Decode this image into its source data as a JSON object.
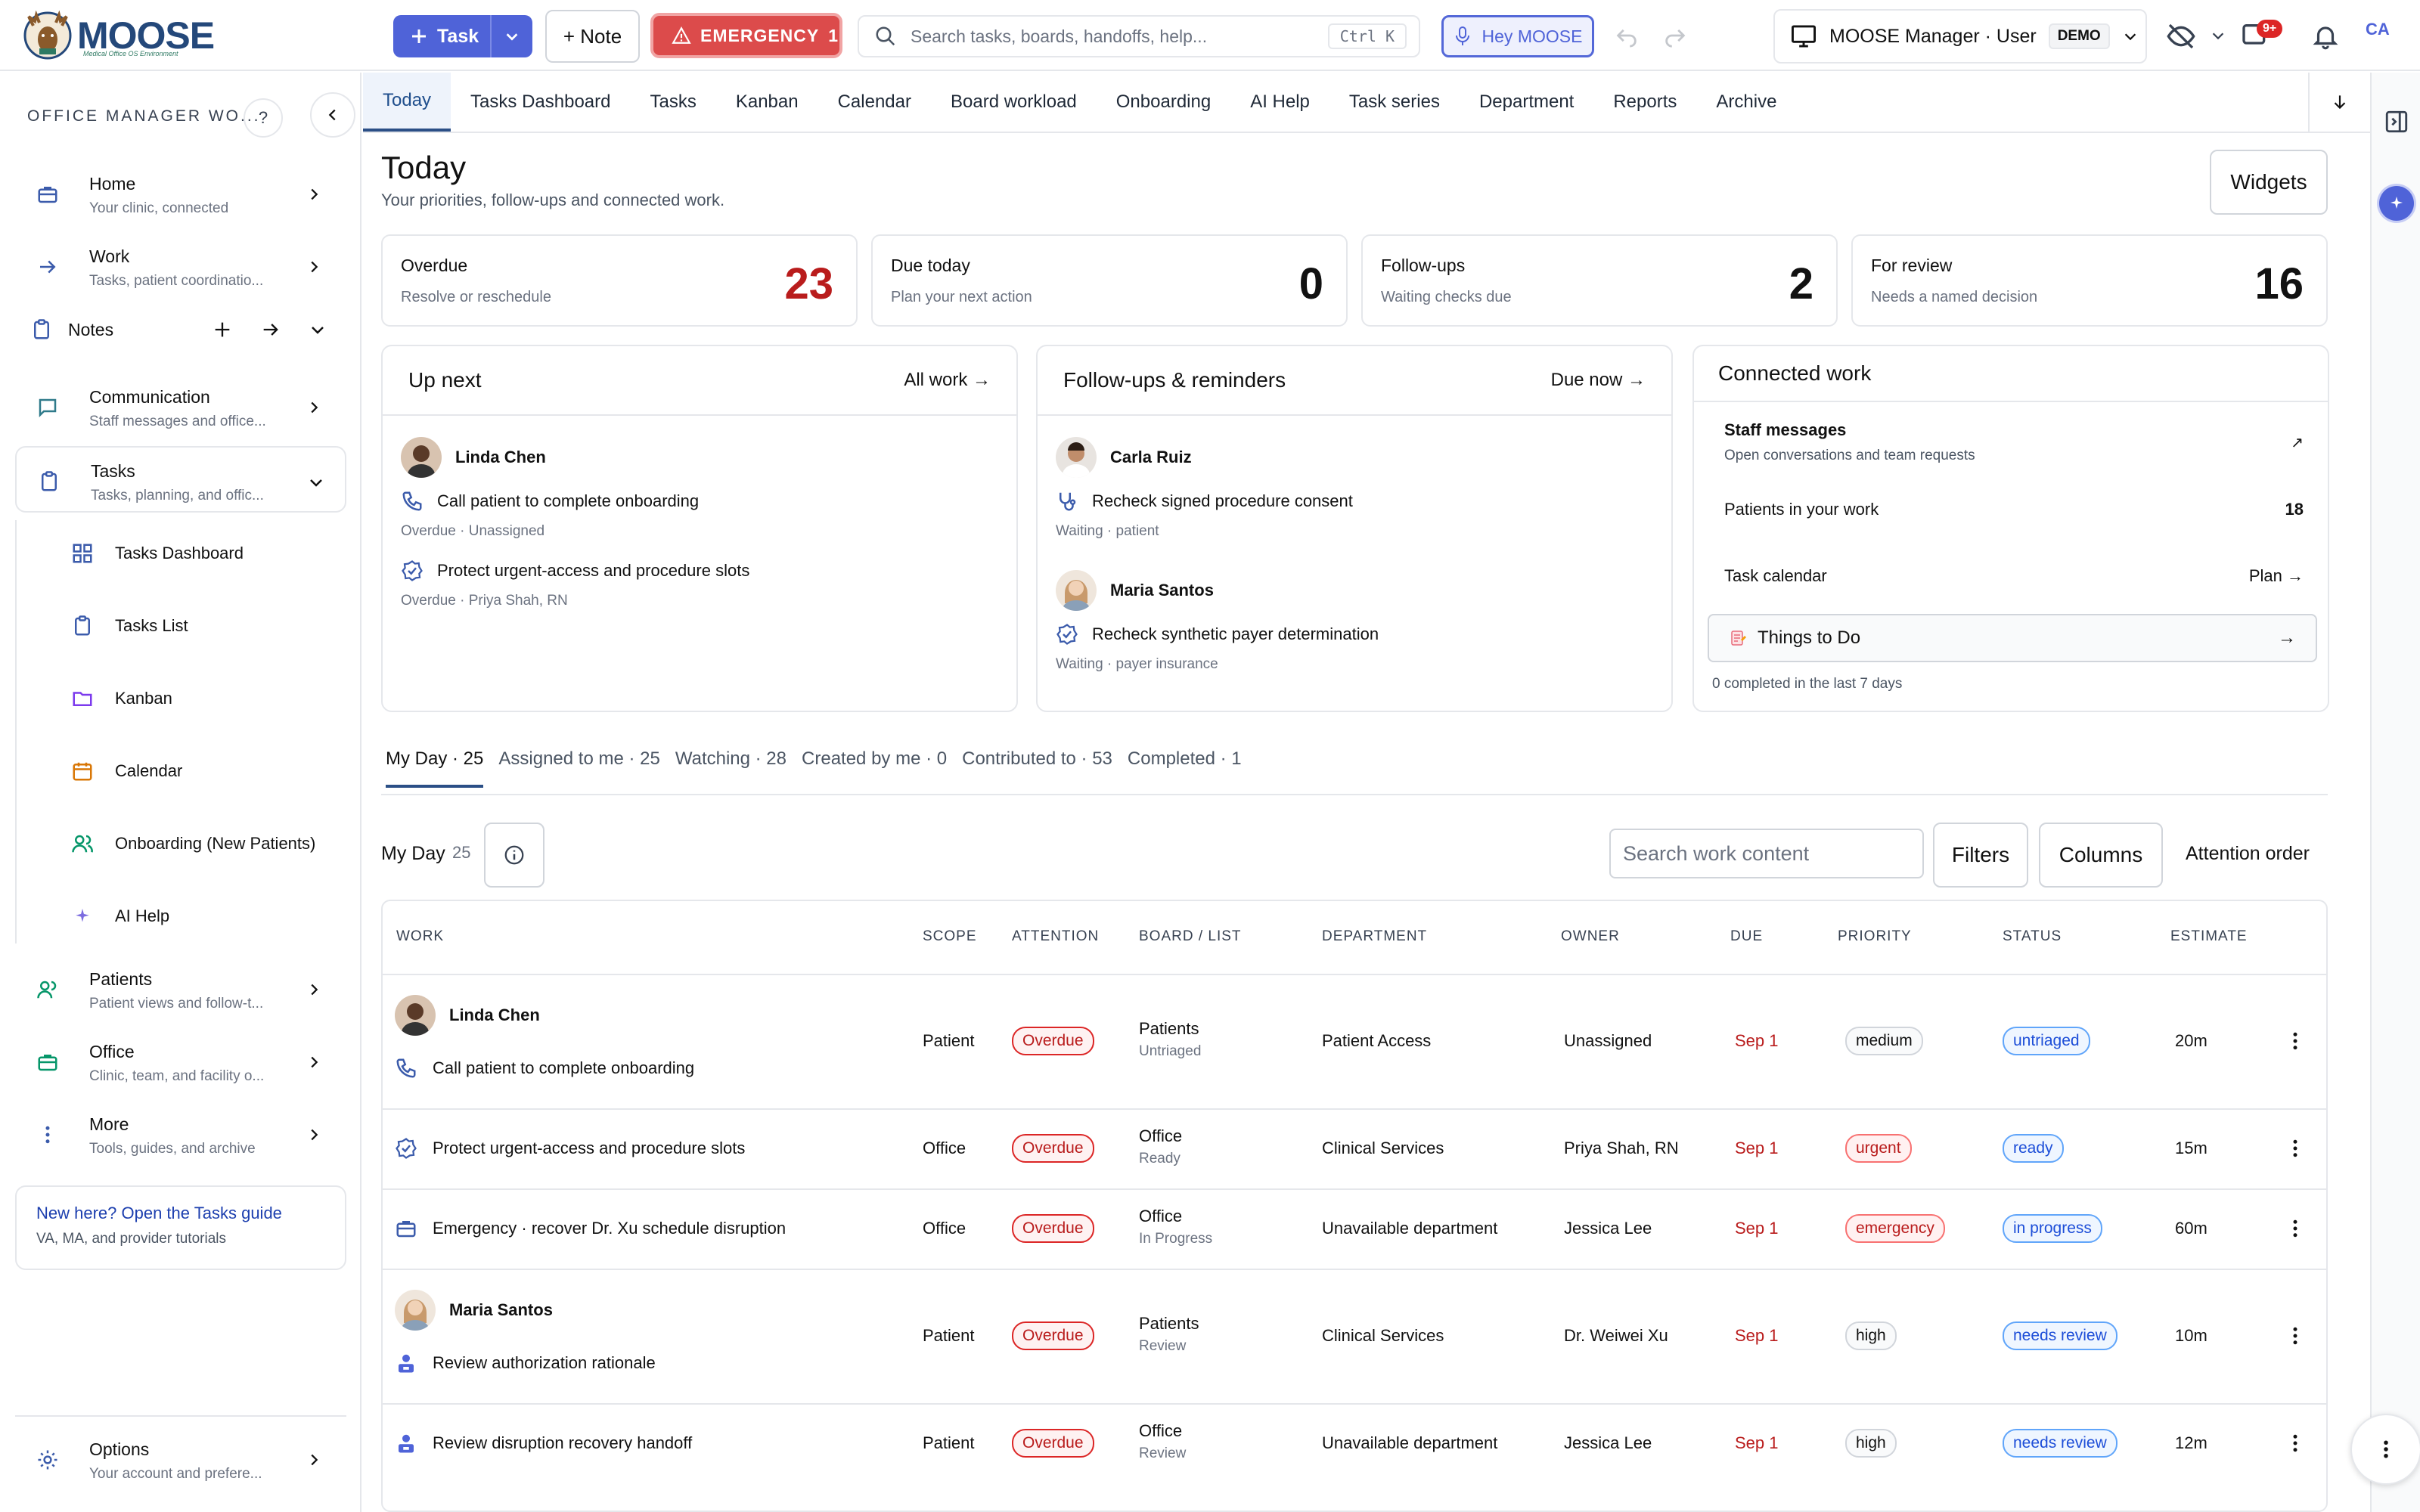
{
  "app": {
    "logo": "MOOSE",
    "logo_sub": "Medical Office OS Environment"
  },
  "topbar": {
    "task_label": "Task",
    "note_label": "+ Note",
    "emergency_label": "EMERGENCY",
    "emergency_count": "1",
    "search_placeholder": "Search tasks, boards, handoffs, help...",
    "search_shortcut": "Ctrl K",
    "hey_label": "Hey MOOSE",
    "user_label": "MOOSE Manager · User",
    "demo_badge": "DEMO",
    "notif_badge": "9+",
    "avatar_initials": "CA"
  },
  "sidebar": {
    "title": "OFFICE MANAGER WO...",
    "help": "?",
    "items": [
      {
        "title": "Home",
        "sub": "Your clinic, connected"
      },
      {
        "title": "Work",
        "sub": "Tasks, patient coordinatio..."
      },
      {
        "title": "Notes"
      },
      {
        "title": "Communication",
        "sub": "Staff messages and office..."
      },
      {
        "title": "Tasks",
        "sub": "Tasks, planning, and offic..."
      },
      {
        "title": "Patients",
        "sub": "Patient views and follow-t..."
      },
      {
        "title": "Office",
        "sub": "Clinic, team, and facility o..."
      },
      {
        "title": "More",
        "sub": "Tools, guides, and archive"
      },
      {
        "title": "Options",
        "sub": "Your account and prefere..."
      }
    ],
    "task_subitems": [
      "Tasks Dashboard",
      "Tasks List",
      "Kanban",
      "Calendar",
      "Onboarding (New Patients)",
      "AI Help"
    ],
    "guide_link": "New here? Open the Tasks guide",
    "guide_sub": "VA, MA, and provider tutorials"
  },
  "tabs": [
    "Today",
    "Tasks Dashboard",
    "Tasks",
    "Kanban",
    "Calendar",
    "Board workload",
    "Onboarding",
    "AI Help",
    "Task series",
    "Department",
    "Reports",
    "Archive"
  ],
  "page": {
    "title": "Today",
    "subtitle": "Your priorities, follow-ups and connected work.",
    "widgets_label": "Widgets"
  },
  "stats": [
    {
      "title": "Overdue",
      "sub": "Resolve or reschedule",
      "value": "23"
    },
    {
      "title": "Due today",
      "sub": "Plan your next action",
      "value": "0"
    },
    {
      "title": "Follow-ups",
      "sub": "Waiting checks due",
      "value": "2"
    },
    {
      "title": "For review",
      "sub": "Needs a named decision",
      "value": "16"
    }
  ],
  "up_next": {
    "title": "Up next",
    "link": "All work →",
    "items": [
      {
        "person": "Linda Chen",
        "task": "Call patient to complete onboarding",
        "meta": "Overdue · Unassigned"
      },
      {
        "task": "Protect urgent-access and procedure slots",
        "meta": "Overdue · Priya Shah, RN"
      }
    ]
  },
  "followups": {
    "title": "Follow-ups & reminders",
    "link": "Due now →",
    "items": [
      {
        "person": "Carla Ruiz",
        "task": "Recheck signed procedure consent",
        "meta": "Waiting · patient"
      },
      {
        "person": "Maria Santos",
        "task": "Recheck synthetic payer determination",
        "meta": "Waiting · payer insurance"
      }
    ]
  },
  "connected": {
    "title": "Connected work",
    "staff_title": "Staff messages",
    "staff_sub": "Open conversations and team requests",
    "staff_arrow": "↗",
    "patients_label": "Patients in your work",
    "patients_value": "18",
    "calendar_label": "Task calendar",
    "calendar_link": "Plan →",
    "things_label": "Things to Do",
    "things_arrow": "→",
    "completed": "0 completed in the last 7 days"
  },
  "subtabs": [
    "My Day · 25",
    "Assigned to me · 25",
    "Watching · 28",
    "Created by me · 0",
    "Contributed to · 53",
    "Completed · 1"
  ],
  "toolbar": {
    "myday_label": "My Day",
    "myday_count": "25",
    "search_placeholder": "Search work content",
    "filters": "Filters",
    "columns": "Columns",
    "attention_order": "Attention order"
  },
  "table": {
    "headers": [
      "WORK",
      "SCOPE",
      "ATTENTION",
      "BOARD / LIST",
      "DEPARTMENT",
      "OWNER",
      "DUE",
      "PRIORITY",
      "STATUS",
      "ESTIMATE"
    ],
    "rows": [
      {
        "person": "Linda Chen",
        "work": "Call patient to complete onboarding",
        "scope": "Patient",
        "attention": "Overdue",
        "board": "Patients",
        "list": "Untriaged",
        "dept": "Patient Access",
        "owner": "Unassigned",
        "due": "Sep 1",
        "priority": "medium",
        "status": "untriaged",
        "estimate": "20m"
      },
      {
        "work": "Protect urgent-access and procedure slots",
        "scope": "Office",
        "attention": "Overdue",
        "board": "Office",
        "list": "Ready",
        "dept": "Clinical Services",
        "owner": "Priya Shah, RN",
        "due": "Sep 1",
        "priority": "urgent",
        "status": "ready",
        "estimate": "15m"
      },
      {
        "work": "Emergency · recover Dr. Xu schedule disruption",
        "scope": "Office",
        "attention": "Overdue",
        "board": "Office",
        "list": "In Progress",
        "dept": "Unavailable department",
        "owner": "Jessica Lee",
        "due": "Sep 1",
        "priority": "emergency",
        "status": "in progress",
        "estimate": "60m"
      },
      {
        "person": "Maria Santos",
        "work": "Review authorization rationale",
        "scope": "Patient",
        "attention": "Overdue",
        "board": "Patients",
        "list": "Review",
        "dept": "Clinical Services",
        "owner": "Dr. Weiwei Xu",
        "due": "Sep 1",
        "priority": "high",
        "status": "needs review",
        "estimate": "10m"
      },
      {
        "work": "Review disruption recovery handoff",
        "scope": "Patient",
        "attention": "Overdue",
        "board": "Office",
        "list": "Review",
        "dept": "Unavailable department",
        "owner": "Jessica Lee",
        "due": "Sep 1",
        "priority": "high",
        "status": "needs review",
        "estimate": "12m"
      }
    ]
  },
  "colors": {
    "accent": "#4f63d8",
    "emergency": "#dc4b4b",
    "overdue": "#b91c1c",
    "status_blue": "#1d4ed8",
    "active_tab_bg": "#eef3fb"
  }
}
